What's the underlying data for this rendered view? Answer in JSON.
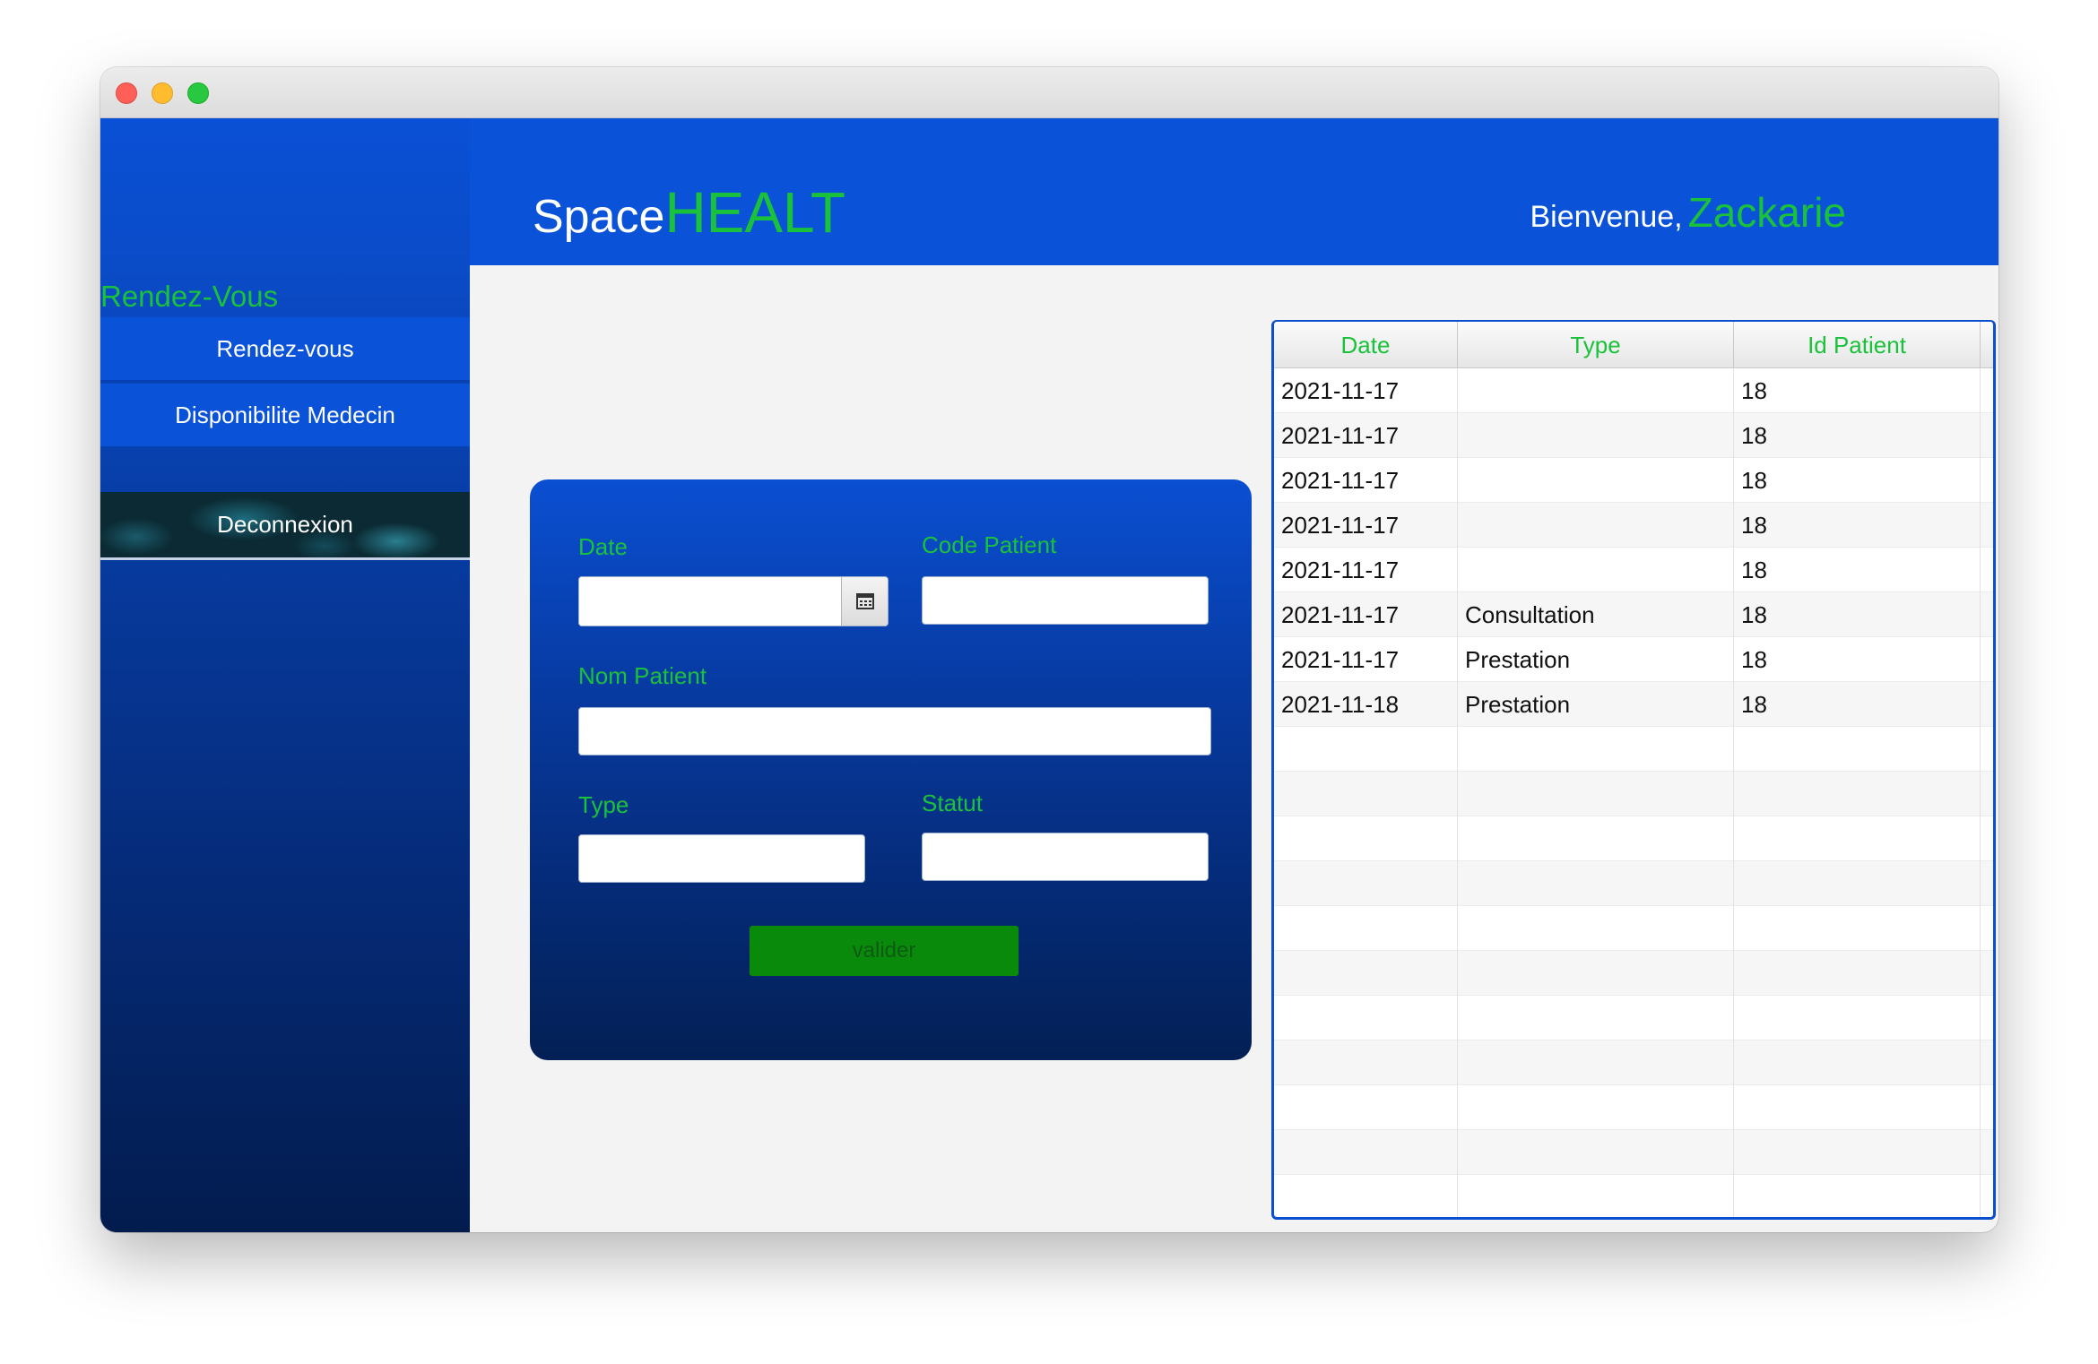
{
  "header": {
    "brand_space": "Space",
    "brand_healt": "HEALT",
    "welcome_label": "Bienvenue,",
    "user_name": "Zackarie"
  },
  "sidebar": {
    "section_title": "Rendez-Vous",
    "items": [
      {
        "label": "Rendez-vous"
      },
      {
        "label": "Disponibilite Medecin"
      }
    ],
    "logout_label": "Deconnexion"
  },
  "form": {
    "date_label": "Date",
    "date_value": "",
    "code_patient_label": "Code Patient",
    "code_patient_value": "",
    "nom_patient_label": "Nom Patient",
    "nom_patient_value": "",
    "type_label": "Type",
    "type_value": "",
    "statut_label": "Statut",
    "statut_value": "",
    "submit_label": "valider"
  },
  "table": {
    "columns": [
      "Date",
      "Type",
      "Id Patient"
    ],
    "rows": [
      [
        "2021-11-17",
        "",
        "18"
      ],
      [
        "2021-11-17",
        "",
        "18"
      ],
      [
        "2021-11-17",
        "",
        "18"
      ],
      [
        "2021-11-17",
        "",
        "18"
      ],
      [
        "2021-11-17",
        "",
        "18"
      ],
      [
        "2021-11-17",
        "Consultation",
        "18"
      ],
      [
        "2021-11-17",
        "Prestation",
        "18"
      ],
      [
        "2021-11-18",
        "Prestation",
        "18"
      ]
    ]
  },
  "colors": {
    "accent_green": "#19c23a",
    "primary_blue": "#0a52d8",
    "button_green": "#0a8a0a"
  },
  "icons": {
    "calendar": "calendar-icon"
  }
}
